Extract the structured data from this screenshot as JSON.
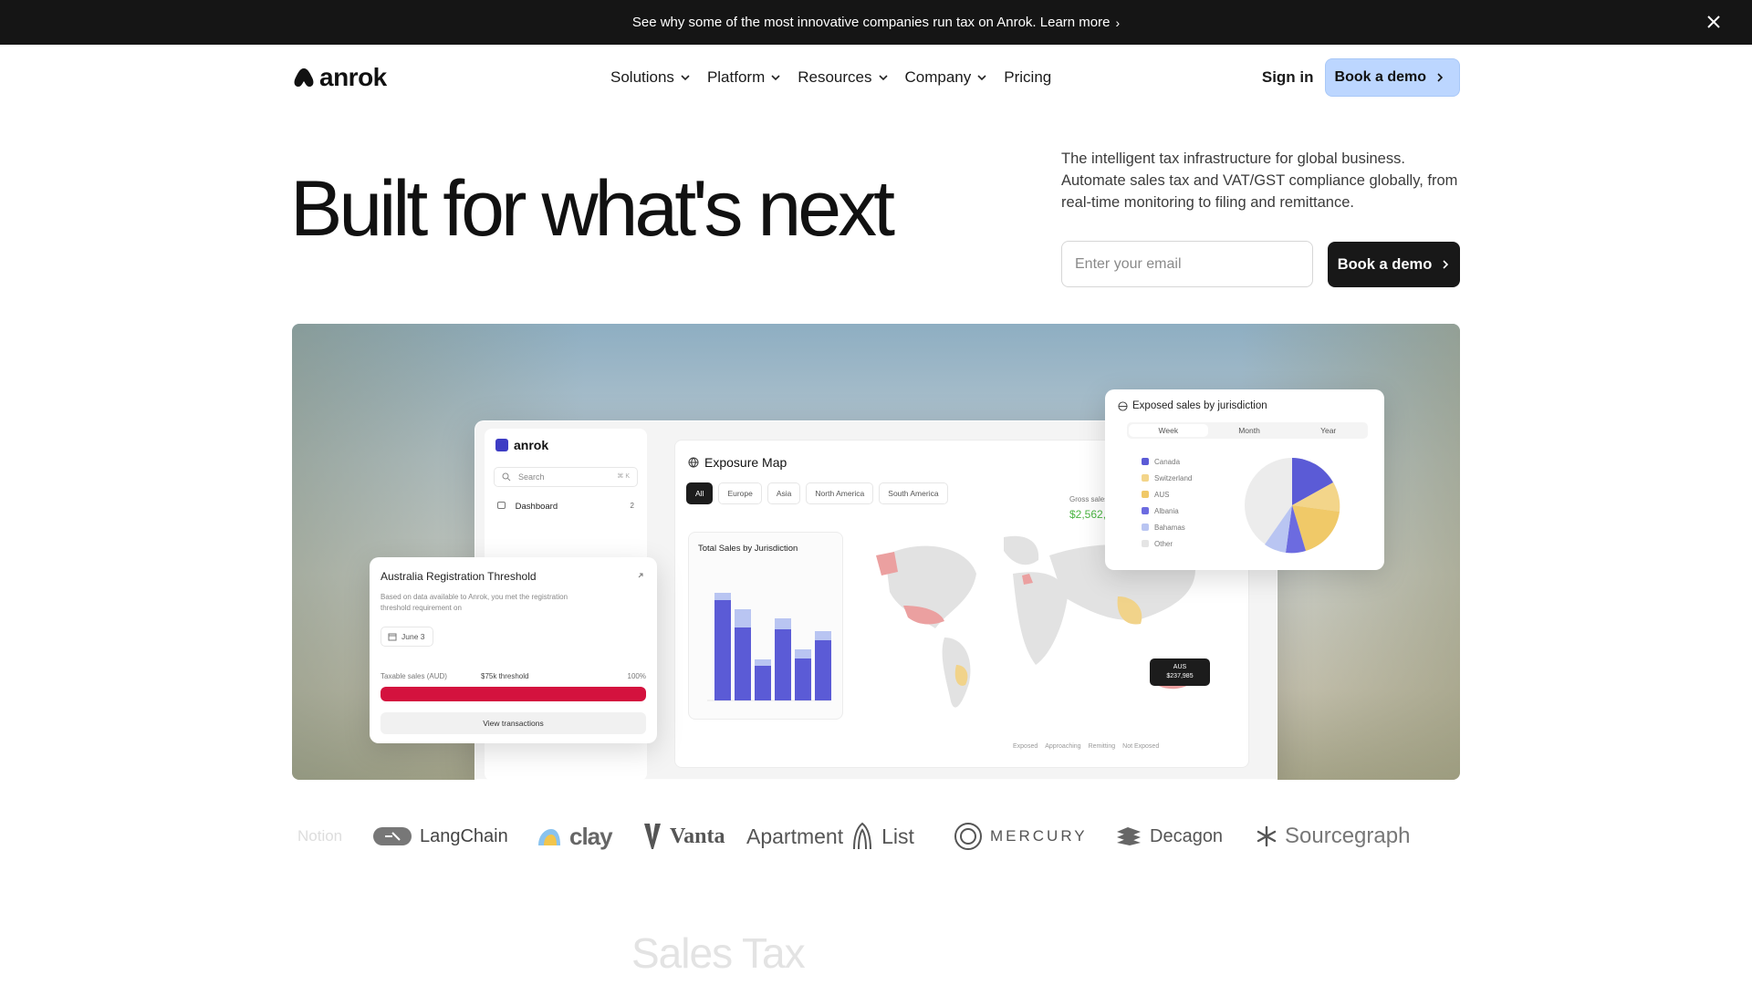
{
  "announcement": {
    "text": "See why some of the most innovative companies run tax on Anrok. Learn more",
    "chevron": "›"
  },
  "nav": {
    "logo_text": "anrok",
    "menu": [
      {
        "label": "Solutions",
        "dropdown": true
      },
      {
        "label": "Platform",
        "dropdown": true
      },
      {
        "label": "Resources",
        "dropdown": true
      },
      {
        "label": "Company",
        "dropdown": true
      },
      {
        "label": "Pricing",
        "dropdown": false
      }
    ],
    "signin": "Sign in",
    "cta": "Book a demo"
  },
  "hero": {
    "title": "Built for what's next",
    "description": "The intelligent tax infrastructure for global business. Automate sales tax and VAT/GST compliance globally, from real-time monitoring to filing and remittance.",
    "email_placeholder": "Enter your email",
    "cta": "Book a demo"
  },
  "dashboard": {
    "app_logo": "anrok",
    "search_placeholder": "Search",
    "search_shortcut": "⌘ K",
    "nav_item": "Dashboard",
    "nav_count": "2",
    "map_title": "Exposure Map",
    "filters": [
      "All",
      "Europe",
      "Asia",
      "North America",
      "South America"
    ],
    "gross_label": "Gross sales",
    "gross_value": "$2,562,",
    "sales_card_title": "Total Sales by Jurisdiction",
    "map_legend": [
      "Exposed",
      "Approaching",
      "Remitting",
      "Not Exposed"
    ],
    "aus_tooltip": {
      "label": "AUS",
      "value": "$237,985"
    },
    "aus_card": {
      "title": "Australia Registration Threshold",
      "sub": "Based on data available to Anrok, you met the registration threshold requirement on",
      "date": "June 3",
      "tax_label": "Taxable sales (AUD)",
      "threshold": "$75k threshold",
      "pct": "100%",
      "view": "View transactions"
    },
    "jurisdiction_card": {
      "title": "Exposed sales by jurisdiction",
      "tabs": [
        "Week",
        "Month",
        "Year"
      ],
      "legend": [
        {
          "name": "Canada",
          "color": "#5b5bd6"
        },
        {
          "name": "Switzerland",
          "color": "#f3d58a"
        },
        {
          "name": "AUS",
          "color": "#f0c968"
        },
        {
          "name": "Albania",
          "color": "#6c6be0"
        },
        {
          "name": "Bahamas",
          "color": "#b9c5f2"
        },
        {
          "name": "Other",
          "color": "#e4e4e4"
        }
      ]
    }
  },
  "logos": [
    "Notion",
    "LangChain",
    "clay",
    "Vanta",
    "Apartment",
    "List",
    "MERCURY",
    "Decagon",
    "Sourcegraph"
  ],
  "section_heading": "Sales Tax",
  "colors": {
    "announcement_bg": "#151515",
    "cta_light": "#bcd6ff",
    "cta_dark": "#181818",
    "alert_red": "#d4123e"
  }
}
